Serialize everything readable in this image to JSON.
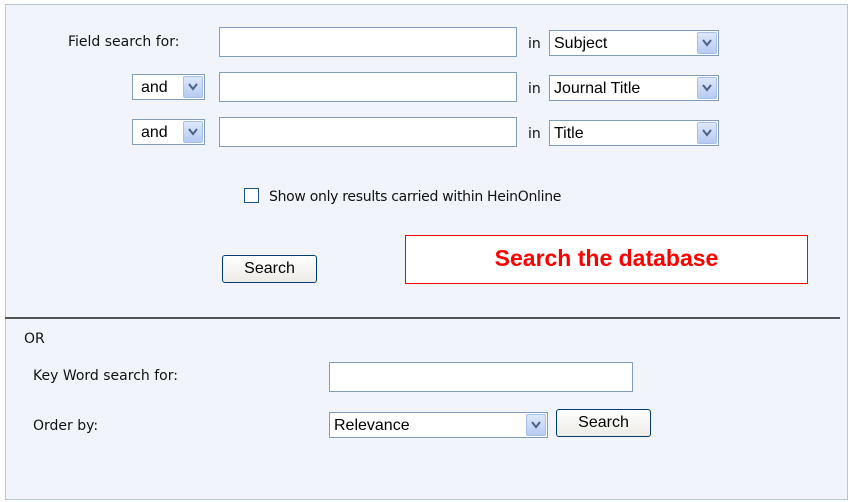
{
  "field_search": {
    "label": "Field search for:",
    "in_word": "in",
    "rows": [
      {
        "operator": "",
        "query": "",
        "field": "Subject"
      },
      {
        "operator": "and",
        "query": "",
        "field": "Journal Title"
      },
      {
        "operator": "and",
        "query": "",
        "field": "Title"
      }
    ],
    "checkbox_label": "Show only results carried within HeinOnline",
    "checkbox_checked": false,
    "search_button": "Search"
  },
  "callout": {
    "text": "Search the database",
    "color": "#ff0000"
  },
  "keyword_search": {
    "or_label": "OR",
    "label": "Key Word search for:",
    "query": "",
    "order_label": "Order by:",
    "order_value": "Relevance",
    "search_button": "Search"
  },
  "colors": {
    "panel_background": "#f1f5fb",
    "input_border": "#7f9db9",
    "button_border": "#003c74"
  }
}
